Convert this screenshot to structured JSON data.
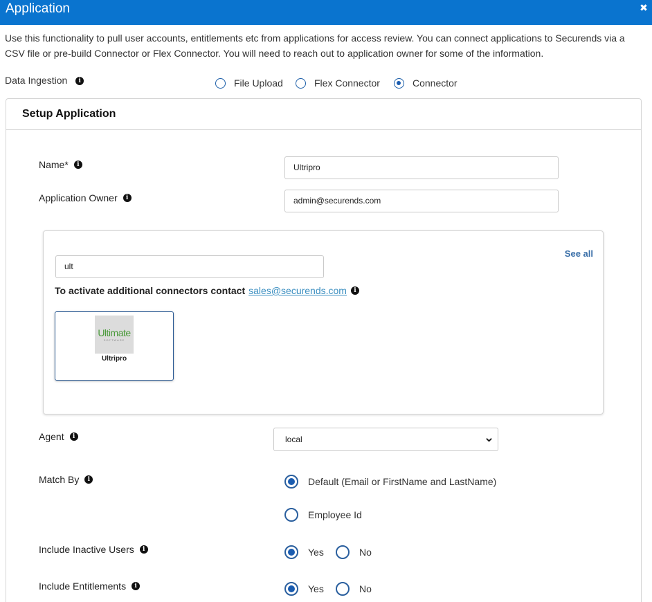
{
  "window": {
    "title": "Application",
    "close_glyph": "✖"
  },
  "description": "Use this functionality to pull user accounts, entitlements etc from applications for access review. You can connect applications to Securends via a CSV file or pre-build Connector or Flex Connector. You will need to reach out to application owner for some of the information.",
  "data_ingestion": {
    "label": "Data Ingestion",
    "options": [
      {
        "label": "File Upload",
        "checked": false
      },
      {
        "label": "Flex Connector",
        "checked": false
      },
      {
        "label": "Connector",
        "checked": true
      }
    ]
  },
  "setup": {
    "heading": "Setup Application",
    "name_label": "Name*",
    "name_value": "Ultripro",
    "owner_label": "Application Owner",
    "owner_value": "admin@securends.com",
    "connectors": {
      "search_value": "ult",
      "see_all": "See all",
      "activate_text": "To activate additional connectors contact",
      "activate_email": "sales@securends.com",
      "cards": [
        {
          "name": "Ultripro",
          "logo_text": "Ultimate",
          "logo_subtext": "SOFTWARE"
        }
      ]
    },
    "agent_label": "Agent",
    "agent_value": "local",
    "match_by": {
      "label": "Match By",
      "options": [
        {
          "label": "Default (Email or FirstName and LastName)",
          "checked": true
        },
        {
          "label": "Employee Id",
          "checked": false
        }
      ]
    },
    "include_inactive": {
      "label": "Include Inactive Users",
      "yes": "Yes",
      "no": "No",
      "selected": "Yes"
    },
    "include_entitlements": {
      "label": "Include Entitlements",
      "yes": "Yes",
      "no": "No",
      "selected": "Yes"
    }
  },
  "colors": {
    "titlebar": "#0a74cf",
    "radio": "#1a5cb0",
    "link": "#3a8ec0",
    "card_border": "#2d5c95"
  },
  "info_icon_glyph": "i"
}
